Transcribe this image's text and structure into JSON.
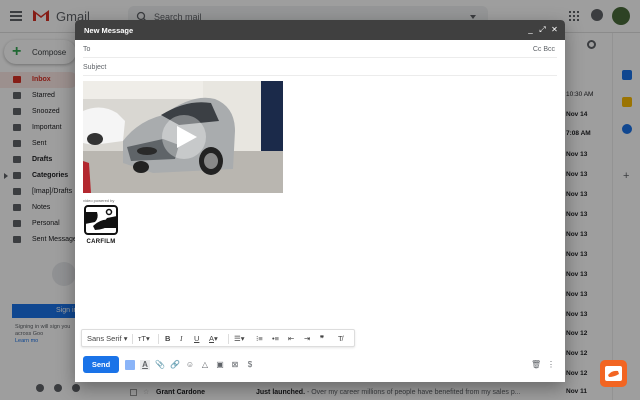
{
  "gmail": {
    "app_name": "Gmail",
    "search_placeholder": "Search mail",
    "compose_label": "Compose",
    "nav": [
      {
        "label": "Inbox"
      },
      {
        "label": "Starred"
      },
      {
        "label": "Snoozed"
      },
      {
        "label": "Important"
      },
      {
        "label": "Sent"
      },
      {
        "label": "Drafts"
      },
      {
        "label": "Categories"
      },
      {
        "label": "[Imap]/Drafts"
      },
      {
        "label": "Notes"
      },
      {
        "label": "Personal"
      },
      {
        "label": "Sent Messages"
      }
    ],
    "signin_label": "Sign in",
    "signin_note_1": "Signing in will sign you",
    "signin_note_2": "across Goo",
    "learn_more": "Learn mo",
    "dates": [
      "10:30 AM",
      "Nov 14",
      "7:08 AM",
      "Nov 13",
      "Nov 13",
      "Nov 13",
      "Nov 13",
      "Nov 13",
      "Nov 13",
      "Nov 13",
      "Nov 13",
      "Nov 13",
      "Nov 12",
      "Nov 12",
      "Nov 12",
      "Nov 12",
      "Nov 12",
      "Nov 11"
    ],
    "bottom_row": {
      "sender": "Grant Cardone",
      "subject": "Just launched.",
      "snippet": " - Over my career millions of people have benefited from my sales p..."
    }
  },
  "compose": {
    "title": "New Message",
    "to_label": "To",
    "cc_bcc": "Cc Bcc",
    "subject_label": "Subject",
    "powered_by": "video powered by",
    "logo_text": "CARFILM",
    "font_select": "Sans Serif",
    "send_label": "Send"
  },
  "colors": {
    "gmail_red": "#d93025",
    "send_blue": "#1a73e8",
    "compose_header": "#404040",
    "extension_orange": "#f26522"
  }
}
